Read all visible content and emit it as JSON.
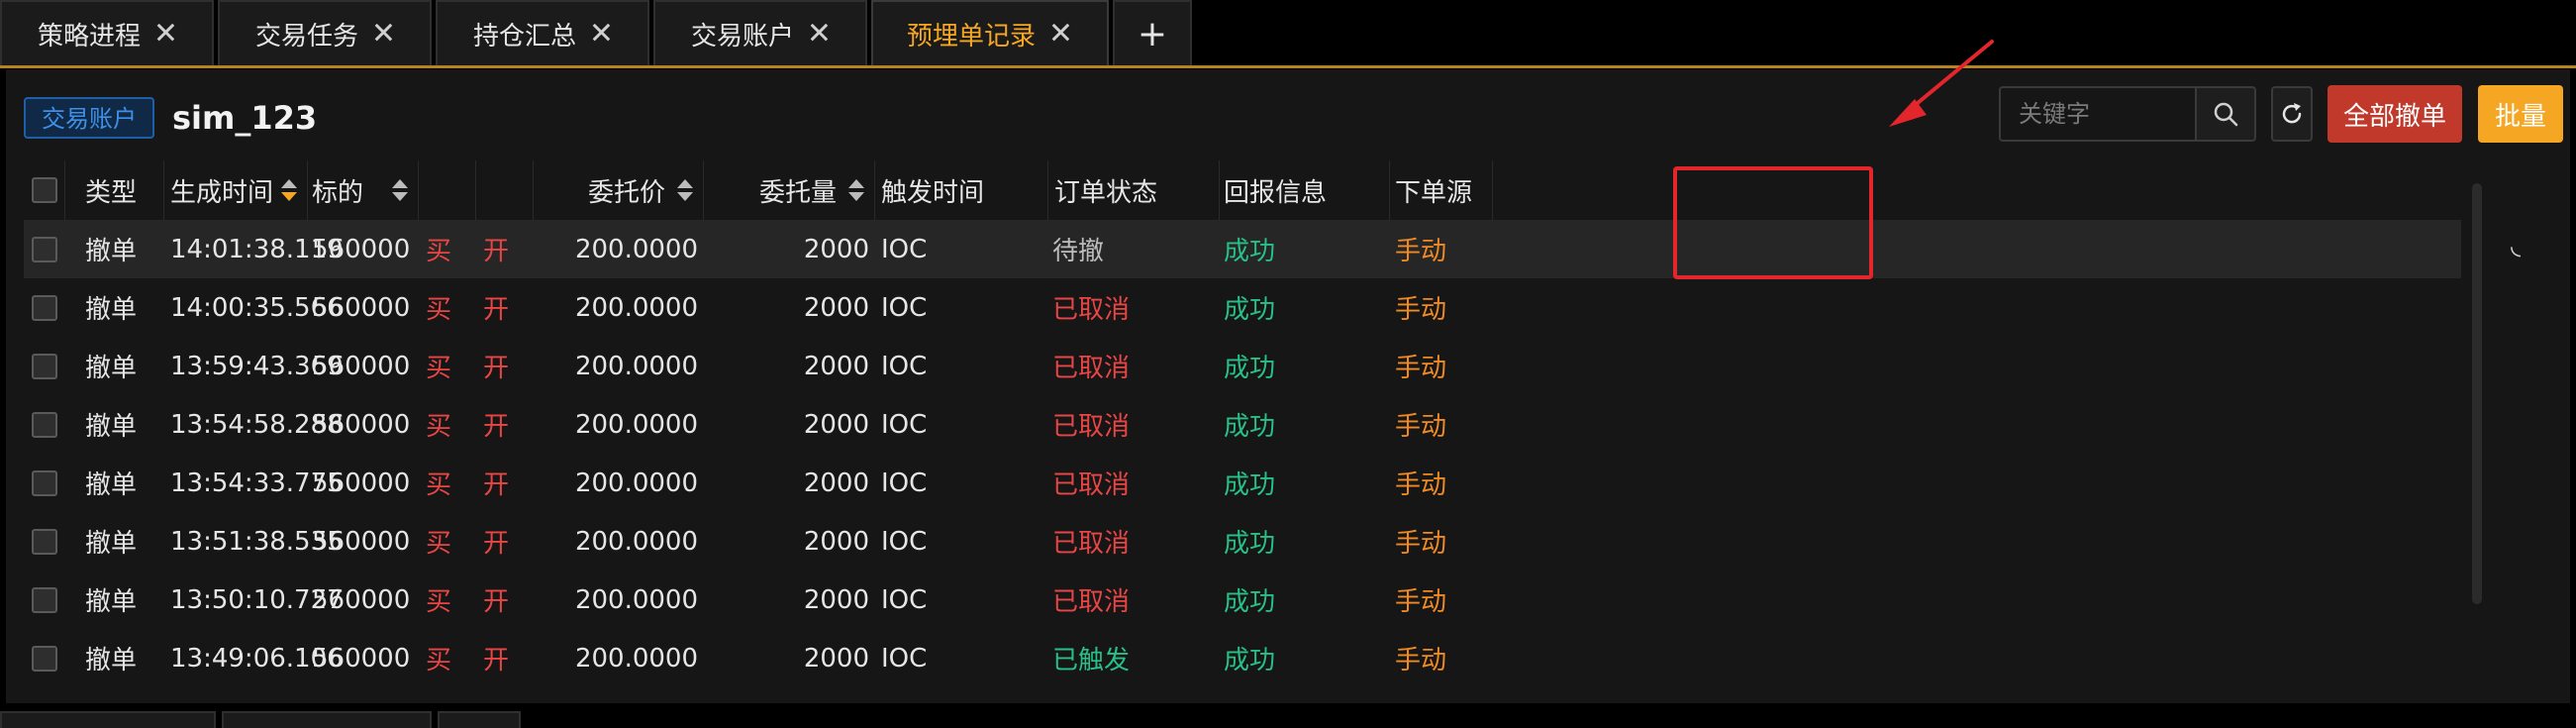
{
  "tabs": [
    {
      "label": "策略进程",
      "active": false
    },
    {
      "label": "交易任务",
      "active": false
    },
    {
      "label": "持仓汇总",
      "active": false
    },
    {
      "label": "交易账户",
      "active": false
    },
    {
      "label": "预埋单记录",
      "active": true
    }
  ],
  "tab_close_glyph": "✕",
  "add_tab_glyph": "+",
  "account": {
    "badge": "交易账户",
    "name": "sim_123"
  },
  "toolbar": {
    "search_placeholder": "关键字",
    "cancel_all_label": "全部撤单",
    "batch_label": "批量"
  },
  "columns": {
    "type": "类型",
    "gen_time": "生成时间",
    "symbol": "标的",
    "price": "委托价",
    "qty": "委托量",
    "trigger": "触发时间",
    "status": "订单状态",
    "reply": "回报信息",
    "source": "下单源"
  },
  "rows": [
    {
      "type": "撤单",
      "time": "14:01:38.119",
      "symbol": "560000",
      "side": "买",
      "open": "开",
      "price": "200.0000",
      "qty": "2000",
      "trigger": "IOC",
      "status": "待撤",
      "reply": "成功",
      "source": "手动"
    },
    {
      "type": "撤单",
      "time": "14:00:35.566",
      "symbol": "560000",
      "side": "买",
      "open": "开",
      "price": "200.0000",
      "qty": "2000",
      "trigger": "IOC",
      "status": "已取消",
      "reply": "成功",
      "source": "手动"
    },
    {
      "type": "撤单",
      "time": "13:59:43.369",
      "symbol": "560000",
      "side": "买",
      "open": "开",
      "price": "200.0000",
      "qty": "2000",
      "trigger": "IOC",
      "status": "已取消",
      "reply": "成功",
      "source": "手动"
    },
    {
      "type": "撤单",
      "time": "13:54:58.288",
      "symbol": "560000",
      "side": "买",
      "open": "开",
      "price": "200.0000",
      "qty": "2000",
      "trigger": "IOC",
      "status": "已取消",
      "reply": "成功",
      "source": "手动"
    },
    {
      "type": "撤单",
      "time": "13:54:33.775",
      "symbol": "560000",
      "side": "买",
      "open": "开",
      "price": "200.0000",
      "qty": "2000",
      "trigger": "IOC",
      "status": "已取消",
      "reply": "成功",
      "source": "手动"
    },
    {
      "type": "撤单",
      "time": "13:51:38.535",
      "symbol": "560000",
      "side": "买",
      "open": "开",
      "price": "200.0000",
      "qty": "2000",
      "trigger": "IOC",
      "status": "已取消",
      "reply": "成功",
      "source": "手动"
    },
    {
      "type": "撤单",
      "time": "13:50:10.727",
      "symbol": "560000",
      "side": "买",
      "open": "开",
      "price": "200.0000",
      "qty": "2000",
      "trigger": "IOC",
      "status": "已取消",
      "reply": "成功",
      "source": "手动"
    },
    {
      "type": "撤单",
      "time": "13:49:06.106",
      "symbol": "560000",
      "side": "买",
      "open": "开",
      "price": "200.0000",
      "qty": "2000",
      "trigger": "IOC",
      "status": "已触发",
      "reply": "成功",
      "source": "手动"
    }
  ],
  "status_colors": {
    "待撤": "#bdbdbd",
    "已取消": "#e84545",
    "已触发": "#28c088"
  },
  "colors": {
    "accent": "#f5a623",
    "danger": "#c0392b",
    "buy": "#e84545",
    "success": "#28c088",
    "manual": "#f08a24"
  },
  "loading_glyph": "◟"
}
